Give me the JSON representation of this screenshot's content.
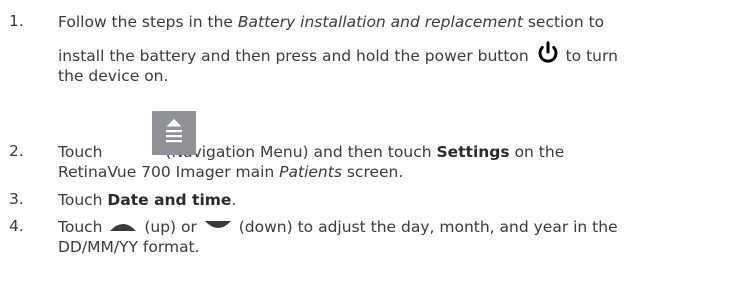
{
  "steps": [
    {
      "number": "1.",
      "line1_a": "Follow the steps in the ",
      "line1_italic": "Battery installation and replacement",
      "line1_b": " section to",
      "line2": "install the battery and then press and hold the power button ",
      "line2_b": " to turn",
      "line3": "the device on.",
      "icon": "power-icon"
    },
    {
      "number": "2.",
      "a": "Touch",
      "b": " (Navigation Menu) and then touch ",
      "bold": "Settings",
      "c": " on the",
      "d": "RetinaVue 700 Imager main ",
      "italic": "Patients",
      "e": " screen.",
      "icon": "navigation-menu-icon"
    },
    {
      "number": "3.",
      "a": "Touch ",
      "bold": "Date and time",
      "b": "."
    },
    {
      "number": "4.",
      "a": "Touch ",
      "b": " (up) or ",
      "c": " (down) to adjust the day, month, and year in the",
      "d": "DD/MM/YY format.",
      "icons": [
        "up-arrow-icon",
        "down-arrow-icon"
      ]
    }
  ],
  "colors": {
    "text": "#3a3a3a",
    "button": "#8e9296"
  }
}
